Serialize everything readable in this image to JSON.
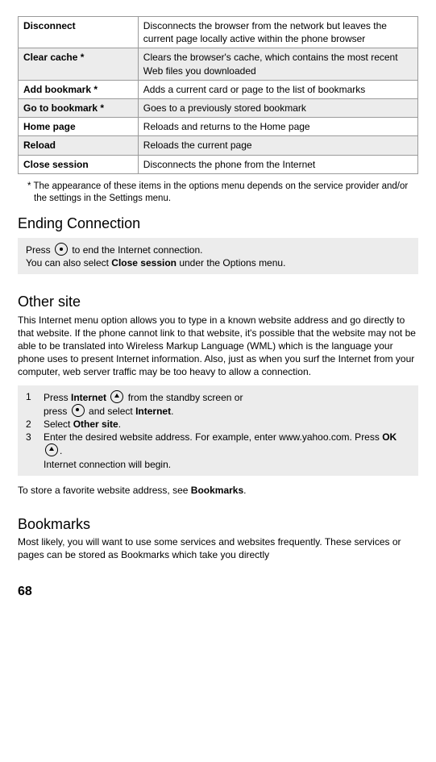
{
  "table": {
    "rows": [
      {
        "term": "Disconnect",
        "desc": "Disconnects the browser from the network but leaves the current page locally active within the phone browser",
        "shaded": false
      },
      {
        "term": "Clear cache *",
        "desc": "Clears the browser's cache, which contains the most recent Web files you downloaded",
        "shaded": true
      },
      {
        "term": "Add bookmark *",
        "desc": "Adds a current card or page to the list of bookmarks",
        "shaded": false
      },
      {
        "term": "Go to bookmark *",
        "desc": "Goes to a previously stored bookmark",
        "shaded": true
      },
      {
        "term": "Home page",
        "desc": "Reloads and returns to the Home page",
        "shaded": false
      },
      {
        "term": "Reload",
        "desc": "Reloads the current page",
        "shaded": true
      },
      {
        "term": "Close session",
        "desc": "Disconnects the phone from the Internet",
        "shaded": false
      }
    ]
  },
  "footnote": "* The appearance of these items in the options menu depends on the service provider and/or the settings in the Settings menu.",
  "ending": {
    "heading": "Ending Connection",
    "line1a": "Press ",
    "line1b": " to end the Internet connection.",
    "line2a": "You can also select ",
    "line2bold": "Close session",
    "line2b": " under the Options menu."
  },
  "othersite": {
    "heading": "Other site",
    "para": "This Internet menu option allows you to type in a known website address and go directly to that website. If the phone cannot link to that website, it's possible that the website may not be able to be translated into Wireless Markup Language (WML) which is the language your phone uses to present Internet information. Also, just as when you surf the Internet from your computer, web server traffic may be too heavy to allow a connection.",
    "steps": {
      "s1": {
        "num": "1",
        "a": "Press ",
        "b1": "Internet",
        "c": " from the standby screen or",
        "d": "press ",
        "e": " and select ",
        "b2": "Internet",
        "f": "."
      },
      "s2": {
        "num": "2",
        "a": "Select ",
        "b": "Other site",
        "c": "."
      },
      "s3": {
        "num": "3",
        "a": "Enter the desired website address. For example, enter www.yahoo.com.  Press ",
        "b": "OK",
        "c": ".",
        "d": "Internet connection will begin."
      }
    },
    "after_a": "To store a favorite website address, see ",
    "after_b": "Bookmarks",
    "after_c": "."
  },
  "bookmarks": {
    "heading": "Bookmarks",
    "para": "Most likely, you will want to use some services and websites frequently. These services or pages can be stored as Bookmarks which take you directly"
  },
  "page_number": "68"
}
